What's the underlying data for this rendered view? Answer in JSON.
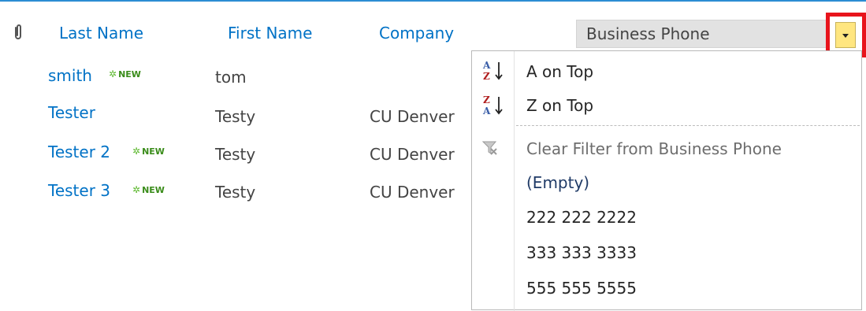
{
  "header": {
    "last_name": "Last Name",
    "first_name": "First Name",
    "company": "Company",
    "business_phone": "Business Phone"
  },
  "badge": {
    "new": "NEW"
  },
  "rows": [
    {
      "last_name": "smith",
      "first_name": "tom",
      "company": "",
      "is_new": true
    },
    {
      "last_name": "Tester",
      "first_name": "Testy",
      "company": "CU Denver",
      "is_new": false
    },
    {
      "last_name": "Tester 2",
      "first_name": "Testy",
      "company": "CU Denver",
      "is_new": true
    },
    {
      "last_name": "Tester 3",
      "first_name": "Testy",
      "company": "CU Denver",
      "is_new": true
    }
  ],
  "filter_menu": {
    "sort_asc": "A on Top",
    "sort_desc": "Z on Top",
    "clear_filter": "Clear Filter from Business Phone",
    "values": [
      "(Empty)",
      "222 222 2222",
      "333 333 3333",
      "555 555 5555"
    ]
  },
  "colors": {
    "link": "#0072c6",
    "highlight": "#e8141c",
    "dropdown_button": "#ffe680"
  }
}
